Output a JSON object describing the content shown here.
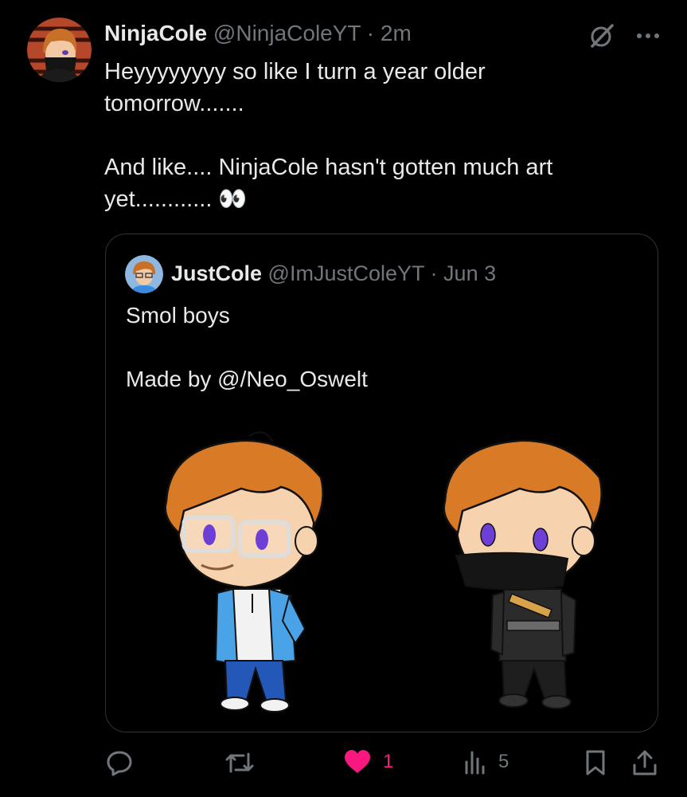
{
  "tweet": {
    "author_name": "NinjaCole",
    "author_handle": "@NinjaColeYT",
    "separator": "·",
    "time": "2m",
    "text_lines": [
      "Heyyyyyyyy so like I turn a year older",
      "tomorrow.......",
      "And like.... NinjaCole hasn't gotten much art",
      "yet............ 👀"
    ]
  },
  "quote": {
    "author_name": "JustCole",
    "author_handle": "@ImJustColeYT",
    "separator": "·",
    "date": "Jun 3",
    "text_line1": "Smol boys",
    "text_line2": "Made by @/Neo_Oswelt"
  },
  "actions": {
    "reply_count": "",
    "repost_count": "",
    "like_count": "1",
    "views_count": "5"
  },
  "icons": [
    "grok-icon",
    "more-icon",
    "reply-icon",
    "repost-icon",
    "heart-icon",
    "views-icon",
    "bookmark-icon",
    "share-icon"
  ],
  "colors": {
    "background": "#000000",
    "text": "#e7e9ea",
    "muted": "#71767b",
    "like": "#f91880",
    "border": "#2f3336"
  }
}
